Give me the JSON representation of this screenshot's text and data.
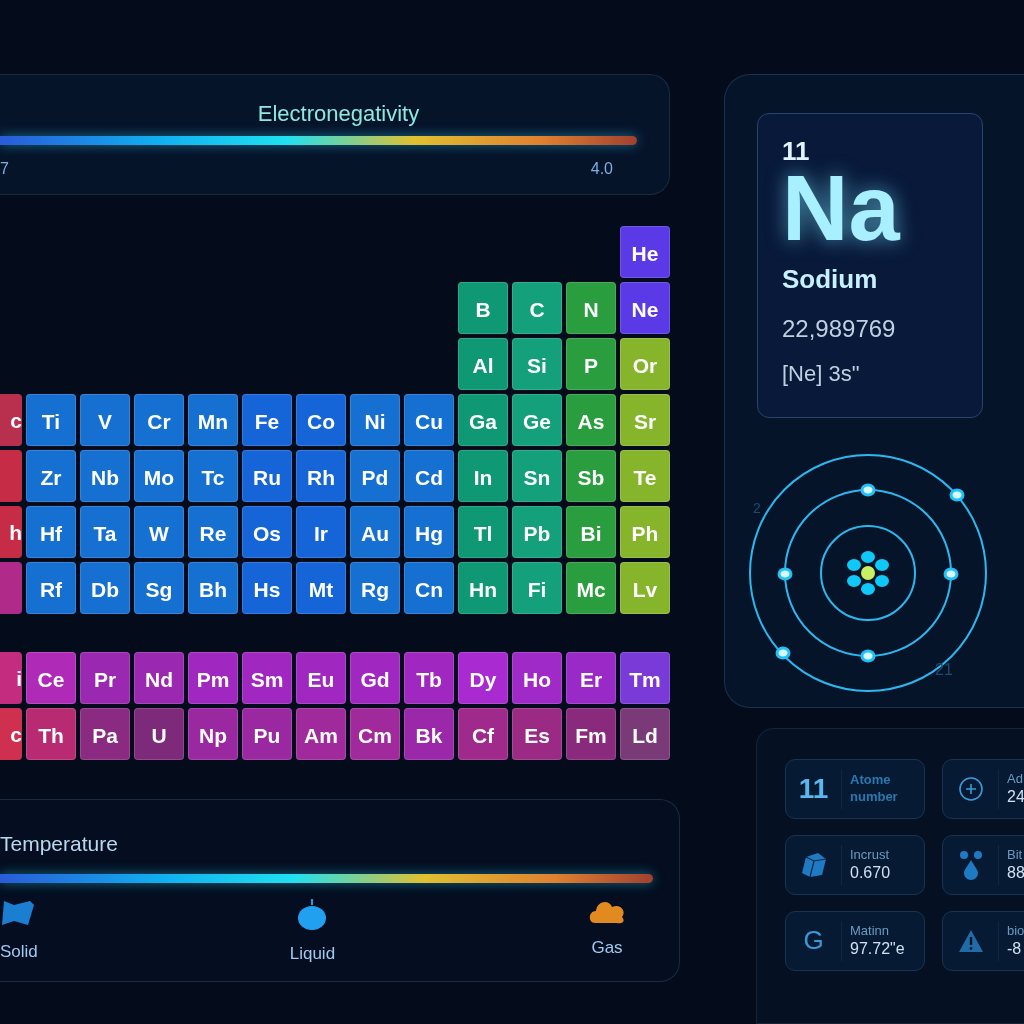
{
  "electronegativity": {
    "title": "Electronegativity",
    "min_label": "7",
    "max_label": "4.0"
  },
  "main_table": {
    "rows": [
      {
        "edge": null,
        "cells": [
          null,
          null,
          null,
          null,
          null,
          null,
          null,
          null,
          null,
          null,
          null,
          {
            "symbol": "He",
            "color": "#5a3ae6"
          }
        ]
      },
      {
        "edge": null,
        "cells": [
          null,
          null,
          null,
          null,
          null,
          null,
          null,
          null,
          {
            "symbol": "B",
            "color": "#0f9874"
          },
          {
            "symbol": "C",
            "color": "#13a07a"
          },
          {
            "symbol": "N",
            "color": "#2a9e3e"
          },
          {
            "symbol": "Ne",
            "color": "#5a3ae6"
          }
        ]
      },
      {
        "edge": null,
        "cells": [
          null,
          null,
          null,
          null,
          null,
          null,
          null,
          null,
          {
            "symbol": "Al",
            "color": "#0f9874"
          },
          {
            "symbol": "Si",
            "color": "#13a07a"
          },
          {
            "symbol": "P",
            "color": "#2a9e3e"
          },
          {
            "symbol": "Or",
            "color": "#86b52c"
          }
        ]
      },
      {
        "edge": {
          "symbol": "c",
          "color": "#b8304e"
        },
        "cells": [
          {
            "symbol": "Ti",
            "color": "#1570d2"
          },
          {
            "symbol": "V",
            "color": "#1570d2"
          },
          {
            "symbol": "Cr",
            "color": "#1570d2"
          },
          {
            "symbol": "Mn",
            "color": "#1570d2"
          },
          {
            "symbol": "Fe",
            "color": "#1565d8"
          },
          {
            "symbol": "Co",
            "color": "#1565d8"
          },
          {
            "symbol": "Ni",
            "color": "#1570d2"
          },
          {
            "symbol": "Cu",
            "color": "#1570d2"
          },
          {
            "symbol": "Ga",
            "color": "#0f9874"
          },
          {
            "symbol": "Ge",
            "color": "#13a07a"
          },
          {
            "symbol": "As",
            "color": "#2a9e3e"
          },
          {
            "symbol": "Sr",
            "color": "#86b52c"
          }
        ]
      },
      {
        "edge": {
          "color": "#c62c46"
        },
        "cells": [
          {
            "symbol": "Zr",
            "color": "#1570d2"
          },
          {
            "symbol": "Nb",
            "color": "#1570d2"
          },
          {
            "symbol": "Mo",
            "color": "#1570d2"
          },
          {
            "symbol": "Tc",
            "color": "#1570d2"
          },
          {
            "symbol": "Ru",
            "color": "#1565d8"
          },
          {
            "symbol": "Rh",
            "color": "#1565d8"
          },
          {
            "symbol": "Pd",
            "color": "#1570d2"
          },
          {
            "symbol": "Cd",
            "color": "#1570d2"
          },
          {
            "symbol": "In",
            "color": "#0f9874"
          },
          {
            "symbol": "Sn",
            "color": "#13a07a"
          },
          {
            "symbol": "Sb",
            "color": "#2a9e3e"
          },
          {
            "symbol": "Te",
            "color": "#86b52c"
          }
        ]
      },
      {
        "edge": {
          "symbol": "h",
          "color": "#c62c46"
        },
        "cells": [
          {
            "symbol": "Hf",
            "color": "#1570d2"
          },
          {
            "symbol": "Ta",
            "color": "#1570d2"
          },
          {
            "symbol": "W",
            "color": "#1570d2"
          },
          {
            "symbol": "Re",
            "color": "#1570d2"
          },
          {
            "symbol": "Os",
            "color": "#1565d8"
          },
          {
            "symbol": "Ir",
            "color": "#1565d8"
          },
          {
            "symbol": "Au",
            "color": "#1570d2"
          },
          {
            "symbol": "Hg",
            "color": "#1570d2"
          },
          {
            "symbol": "Tl",
            "color": "#0f9874"
          },
          {
            "symbol": "Pb",
            "color": "#13a07a"
          },
          {
            "symbol": "Bi",
            "color": "#2a9e3e"
          },
          {
            "symbol": "Ph",
            "color": "#86b52c"
          }
        ]
      },
      {
        "edge": {
          "color": "#b02a8a"
        },
        "cells": [
          {
            "symbol": "Rf",
            "color": "#1570d2"
          },
          {
            "symbol": "Db",
            "color": "#1570d2"
          },
          {
            "symbol": "Sg",
            "color": "#1570d2"
          },
          {
            "symbol": "Bh",
            "color": "#1570d2"
          },
          {
            "symbol": "Hs",
            "color": "#1565d8"
          },
          {
            "symbol": "Mt",
            "color": "#1565d8"
          },
          {
            "symbol": "Rg",
            "color": "#1570d2"
          },
          {
            "symbol": "Cn",
            "color": "#1570d2"
          },
          {
            "symbol": "Hn",
            "color": "#0f9874"
          },
          {
            "symbol": "Fi",
            "color": "#13a07a"
          },
          {
            "symbol": "Mc",
            "color": "#2a9e3e"
          },
          {
            "symbol": "Lv",
            "color": "#86b52c"
          }
        ]
      }
    ]
  },
  "series_table": {
    "rows": [
      {
        "edge": {
          "symbol": "i",
          "color": "#c42c80"
        },
        "cells": [
          {
            "symbol": "Ce",
            "color": "#b02ab8"
          },
          {
            "symbol": "Pr",
            "color": "#9a28b0"
          },
          {
            "symbol": "Nd",
            "color": "#9a28b0"
          },
          {
            "symbol": "Pm",
            "color": "#a028c0"
          },
          {
            "symbol": "Sm",
            "color": "#a028c0"
          },
          {
            "symbol": "Eu",
            "color": "#a028c0"
          },
          {
            "symbol": "Gd",
            "color": "#a028c0"
          },
          {
            "symbol": "Tb",
            "color": "#a028c0"
          },
          {
            "symbol": "Dy",
            "color": "#a82ad0"
          },
          {
            "symbol": "Ho",
            "color": "#a02ac8"
          },
          {
            "symbol": "Er",
            "color": "#9a2ac8"
          },
          {
            "symbol": "Tm",
            "color": "#7a3ad8"
          }
        ]
      },
      {
        "edge": {
          "symbol": "c",
          "color": "#d03050"
        },
        "cells": [
          {
            "symbol": "Th",
            "color": "#b82a72"
          },
          {
            "symbol": "Pa",
            "color": "#8a2a80"
          },
          {
            "symbol": "U",
            "color": "#7e2a7a"
          },
          {
            "symbol": "Np",
            "color": "#9a28a0"
          },
          {
            "symbol": "Pu",
            "color": "#9a28a0"
          },
          {
            "symbol": "Am",
            "color": "#a02a9c"
          },
          {
            "symbol": "Cm",
            "color": "#a02a9c"
          },
          {
            "symbol": "Bk",
            "color": "#9a28a8"
          },
          {
            "symbol": "Cf",
            "color": "#a02a8c"
          },
          {
            "symbol": "Es",
            "color": "#9a2a84"
          },
          {
            "symbol": "Fm",
            "color": "#8a2a7c"
          },
          {
            "symbol": "Ld",
            "color": "#7a3a78"
          }
        ]
      }
    ]
  },
  "temperature": {
    "title": "Temperature",
    "phases": [
      {
        "kind": "solid",
        "label": "Solid"
      },
      {
        "kind": "liquid",
        "label": "Liquid"
      },
      {
        "kind": "gas",
        "label": "Gas"
      }
    ]
  },
  "element_card": {
    "number": "11",
    "symbol": "Na",
    "name": "Sodium",
    "mass": "22,989769",
    "configuration": "[Ne] 3s\""
  },
  "atom_diagram": {
    "labels": [
      "2",
      "21"
    ]
  },
  "stats": [
    {
      "kind": "number",
      "value": "11",
      "label": "Atome number"
    },
    {
      "kind": "plus",
      "label": "Ad",
      "value": "24"
    },
    {
      "kind": "cube",
      "label": "Incrust",
      "value": "0.670"
    },
    {
      "kind": "drops",
      "label": "Bit",
      "value": "88"
    },
    {
      "kind": "letter",
      "glyph": "G",
      "label": "Matinn",
      "value": "97.72\"e"
    },
    {
      "kind": "warning",
      "label": "bio",
      "value": "-8"
    }
  ]
}
